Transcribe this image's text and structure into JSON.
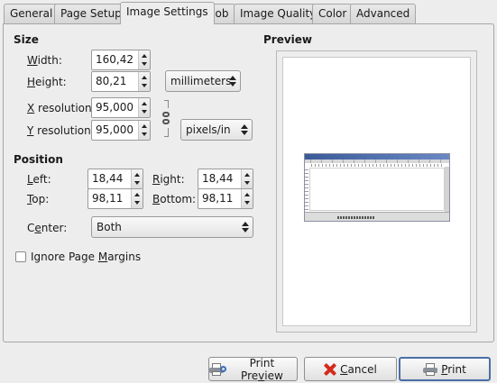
{
  "tabs": [
    {
      "label": "General"
    },
    {
      "label": "Page Setup"
    },
    {
      "label": "Image Settings",
      "active": true
    },
    {
      "label": "Job"
    },
    {
      "label": "Image Quality"
    },
    {
      "label": "Color"
    },
    {
      "label": "Advanced"
    }
  ],
  "size": {
    "title": "Size",
    "width": {
      "label": "Width:",
      "mnemonic": "W",
      "rest": "idth:",
      "value": "160,42"
    },
    "height": {
      "label": "Height:",
      "mnemonic": "H",
      "rest": "eight:",
      "value": "80,21"
    },
    "unit": "millimeters",
    "x_resolution": {
      "label": "X resolution:",
      "mnemonic": "X",
      "rest": " resolution:",
      "value": "95,000"
    },
    "y_resolution": {
      "label": "Y resolution:",
      "mnemonic": "Y",
      "rest": " resolution:",
      "value": "95,000"
    },
    "resolution_unit": "pixels/in"
  },
  "position": {
    "title": "Position",
    "left": {
      "label": "Left:",
      "mnemonic": "L",
      "rest": "eft:",
      "value": "18,44"
    },
    "right": {
      "label": "Right:",
      "mnemonic": "R",
      "rest": "ight:",
      "value": "18,44"
    },
    "top": {
      "label": "Top:",
      "mnemonic": "T",
      "rest": "op:",
      "value": "98,11"
    },
    "bottom": {
      "label": "Bottom:",
      "mnemonic": "B",
      "rest": "ottom:",
      "value": "98,11"
    },
    "center": {
      "label": "Center:",
      "pre": "C",
      "mnemonic": "e",
      "rest": "nter:",
      "value": "Both"
    }
  },
  "ignore_margins": {
    "label": "Ignore Page Margins",
    "pre": "Ignore Page ",
    "mnemonic": "M",
    "rest": "argins",
    "checked": false
  },
  "preview": {
    "title": "Preview"
  },
  "buttons": {
    "print_preview": {
      "pre": "Print Pre",
      "mnemonic": "v",
      "rest": "iew"
    },
    "cancel": {
      "mnemonic": "C",
      "rest": "ancel"
    },
    "print": {
      "mnemonic": "P",
      "rest": "rint"
    }
  },
  "icons": {
    "print_preview": "print-preview-icon",
    "cancel": "cancel-icon",
    "print": "printer-icon",
    "chain": "chain-link-icon"
  }
}
